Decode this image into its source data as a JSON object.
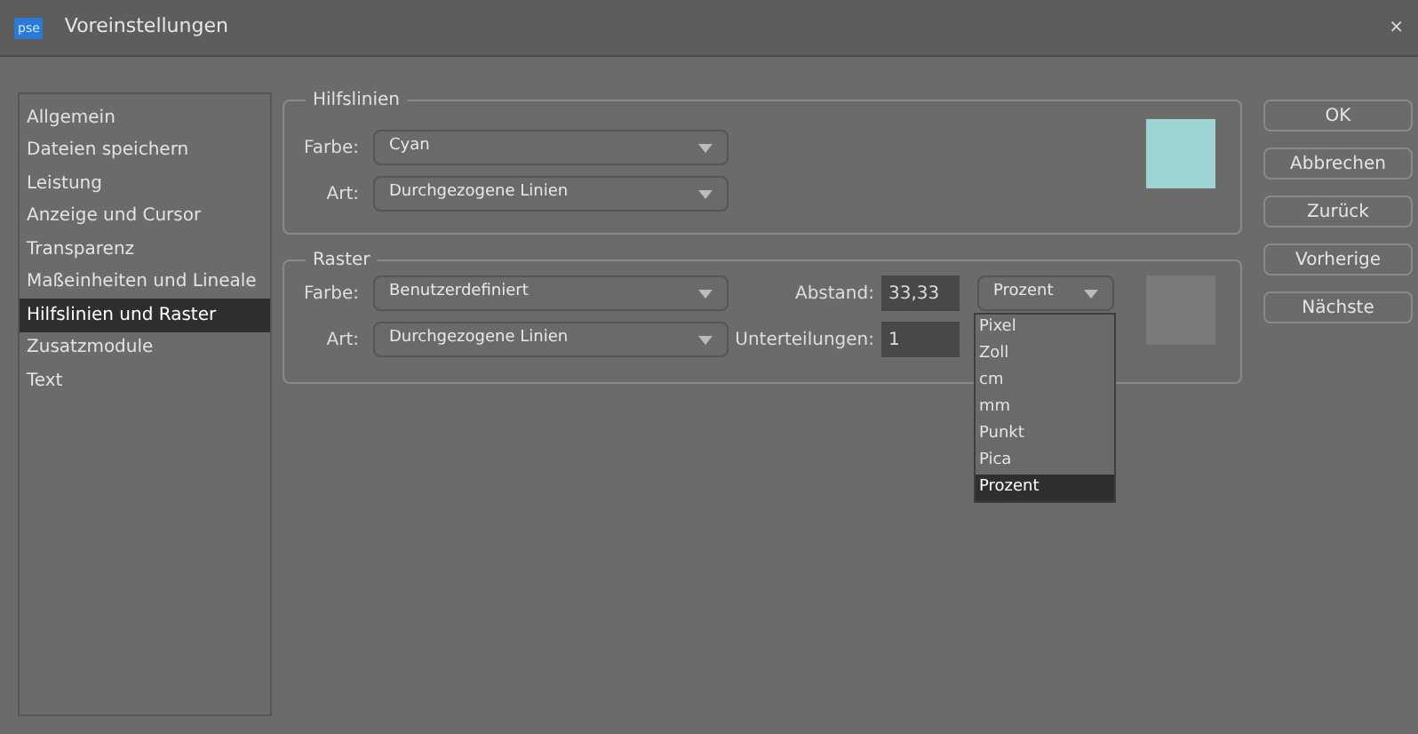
{
  "window": {
    "title": "Voreinstellungen",
    "app_badge": "pse",
    "close": "×"
  },
  "sidebar": {
    "items": [
      {
        "label": "Allgemein",
        "selected": false
      },
      {
        "label": "Dateien speichern",
        "selected": false
      },
      {
        "label": "Leistung",
        "selected": false
      },
      {
        "label": "Anzeige und Cursor",
        "selected": false
      },
      {
        "label": "Transparenz",
        "selected": false
      },
      {
        "label": "Maßeinheiten und Lineale",
        "selected": false
      },
      {
        "label": "Hilfslinien und Raster",
        "selected": true
      },
      {
        "label": "Zusatzmodule",
        "selected": false
      },
      {
        "label": "Text",
        "selected": false
      }
    ]
  },
  "guides": {
    "title": "Hilfslinien",
    "color_label": "Farbe:",
    "color_value": "Cyan",
    "style_label": "Art:",
    "style_value": "Durchgezogene Linien",
    "color": "#9ed3d3"
  },
  "grid": {
    "title": "Raster",
    "color_label": "Farbe:",
    "color_value": "Benutzerdefiniert",
    "style_label": "Art:",
    "style_value": "Durchgezogene Linien",
    "spacing_label": "Abstand:",
    "spacing_value": "33,33",
    "unit_value": "Prozent",
    "subdivisions_label": "Unterteilungen:",
    "subdivisions_value": "1",
    "color": "#7a7a7a",
    "unit_menu": [
      {
        "label": "Pixel",
        "selected": false
      },
      {
        "label": "Zoll",
        "selected": false
      },
      {
        "label": "cm",
        "selected": false
      },
      {
        "label": "mm",
        "selected": false
      },
      {
        "label": "Punkt",
        "selected": false
      },
      {
        "label": "Pica",
        "selected": false
      },
      {
        "label": "Prozent",
        "selected": true
      }
    ]
  },
  "buttons": [
    "OK",
    "Abbrechen",
    "Zurück",
    "Vorherige",
    "Nächste"
  ]
}
